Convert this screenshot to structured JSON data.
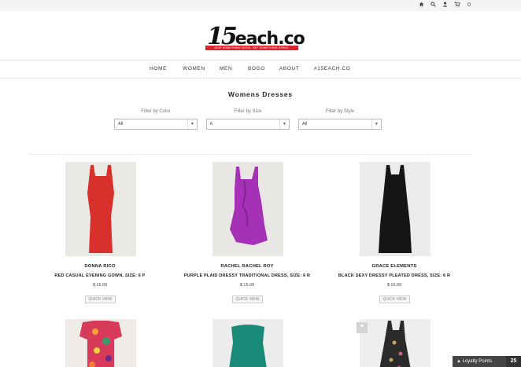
{
  "topbar": {
    "icons": [
      "home-icon",
      "search-icon",
      "user-icon",
      "cart-icon"
    ],
    "cart_count": "0"
  },
  "logo": {
    "number": "15",
    "word": "each.co",
    "tagline": "GIVE SOMETHING GOOD. GET SOMETHING GREAT."
  },
  "nav": {
    "items": [
      {
        "label": "HOME"
      },
      {
        "label": "WOMEN"
      },
      {
        "label": "MEN"
      },
      {
        "label": "BOGO"
      },
      {
        "label": "ABOUT"
      },
      {
        "label": "#15EACH.CO"
      }
    ]
  },
  "page": {
    "heading": "Womens Dresses"
  },
  "filters": [
    {
      "label": "Filter by Color",
      "value": "All"
    },
    {
      "label": "Filter by Size",
      "value": "6"
    },
    {
      "label": "Filter by Style",
      "value": "All"
    }
  ],
  "products": [
    {
      "brand": "DONNA RICO",
      "title": "RED CASUAL EVENING GOWN, SIZE: 6 P",
      "price": "$ 15.00",
      "quick_view": "QUICK VIEW",
      "color": "#d8302a"
    },
    {
      "brand": "RACHEL RACHEL ROY",
      "title": "PURPLE PLAID DRESSY TRADITIONAL DRESS, SIZE: 6 R",
      "price": "$ 15.00",
      "quick_view": "QUICK VIEW",
      "color": "#a531b6"
    },
    {
      "brand": "GRACE ELEMENTS",
      "title": "BLACK SEXY DRESSY PLEATED DRESS, SIZE: 6 R",
      "price": "$ 15.00",
      "quick_view": "QUICK VIEW",
      "color": "#151515"
    }
  ],
  "products_row2": [
    {
      "color": "#d83a5a"
    },
    {
      "color": "#1a8a78"
    },
    {
      "color": "#2b2b2b"
    }
  ],
  "loyalty": {
    "label": "Loyalty Points",
    "points": "25"
  }
}
